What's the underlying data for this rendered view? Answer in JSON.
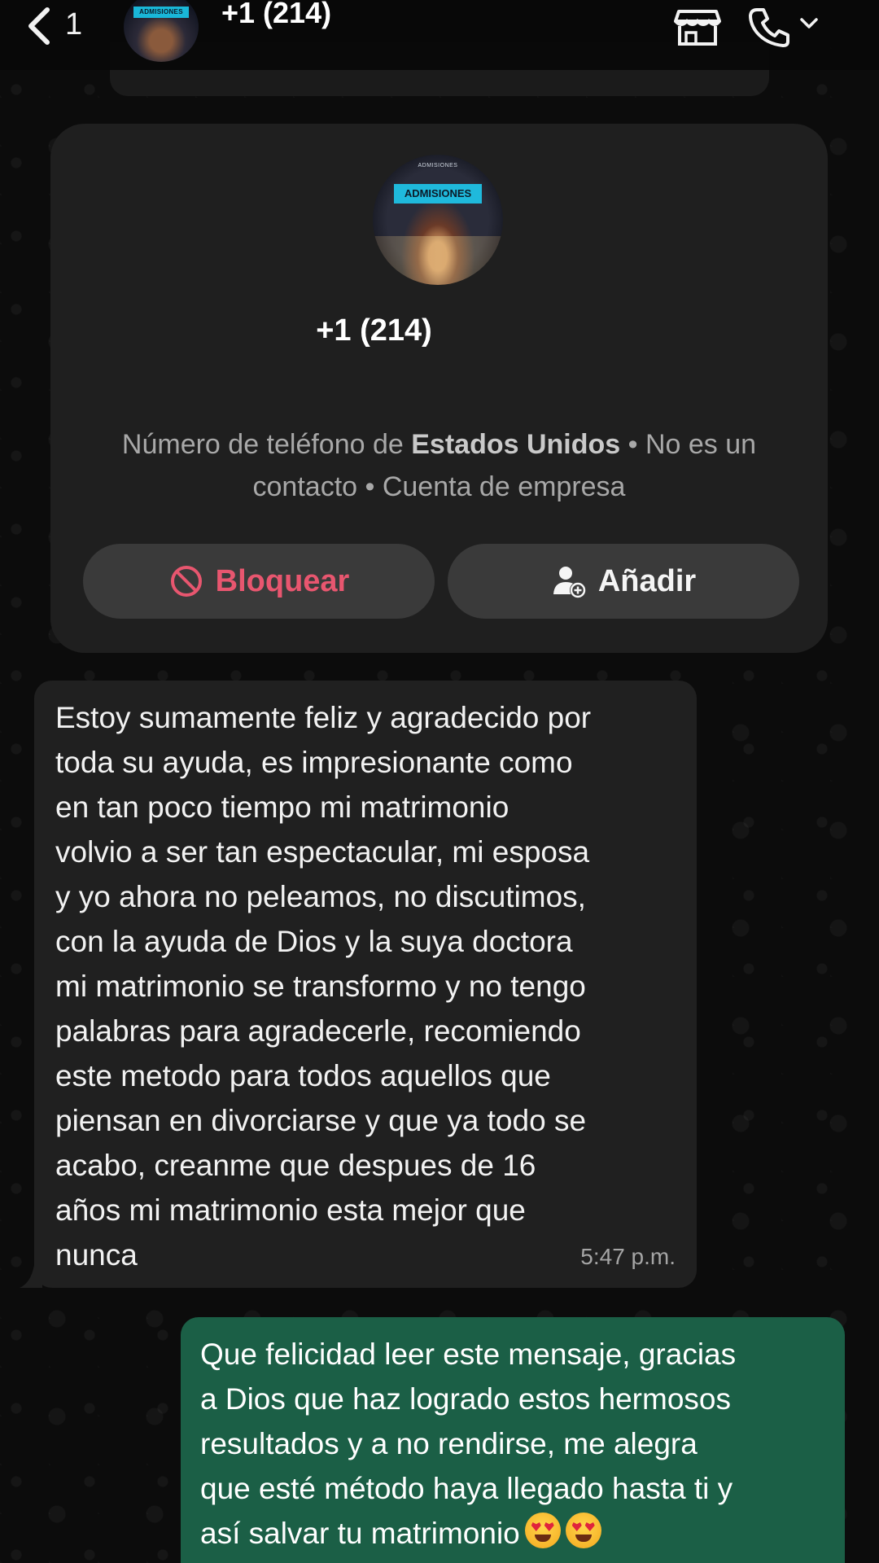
{
  "header": {
    "back_count": "1",
    "avatar_band": "ADMISIONES",
    "title": "+1 (214)",
    "icons": [
      "chevron-left-icon",
      "store-icon",
      "phone-icon",
      "chevron-down-icon"
    ]
  },
  "contact_card": {
    "avatar_small_text": "ADMISIONES",
    "avatar_band": "ADMISIONES",
    "phone": "+1 (214)",
    "desc_part1": "Número de teléfono de ",
    "desc_country": "Estados Unidos",
    "desc_part2": " • No es un contacto • Cuenta de empresa",
    "block_label": "Bloquear",
    "add_label": "Añadir"
  },
  "messages": {
    "incoming": {
      "text": "Estoy sumamente feliz y agradecido por\ntoda su ayuda, es impresionante como\nen tan poco tiempo mi matrimonio\nvolvio a ser tan espectacular, mi esposa\ny yo ahora no peleamos, no discutimos,\ncon la ayuda de Dios y la suya doctora\nmi matrimonio se transformo y no tengo\npalabras para agradecerle, recomiendo\neste metodo para todos aquellos que\npiensan en divorciarse y que ya todo se\nacabo, creanme que despues de 16\naños mi matrimonio esta mejor que\nnunca",
      "time": "5:47 p.m."
    },
    "outgoing": {
      "text": "Que felicidad leer este mensaje, gracias\na Dios que haz logrado estos hermosos\nresultados y a no rendirse, me alegra\nque esté método haya llegado hasta ti y\nasí salvar tu matrimonio",
      "emojis": [
        "heart-eyes",
        "heart-eyes"
      ]
    }
  },
  "colors": {
    "incoming_bubble": "#202020",
    "outgoing_bubble": "#1b5f46",
    "block_red": "#e8566f",
    "card_bg": "#1f1f1f"
  }
}
